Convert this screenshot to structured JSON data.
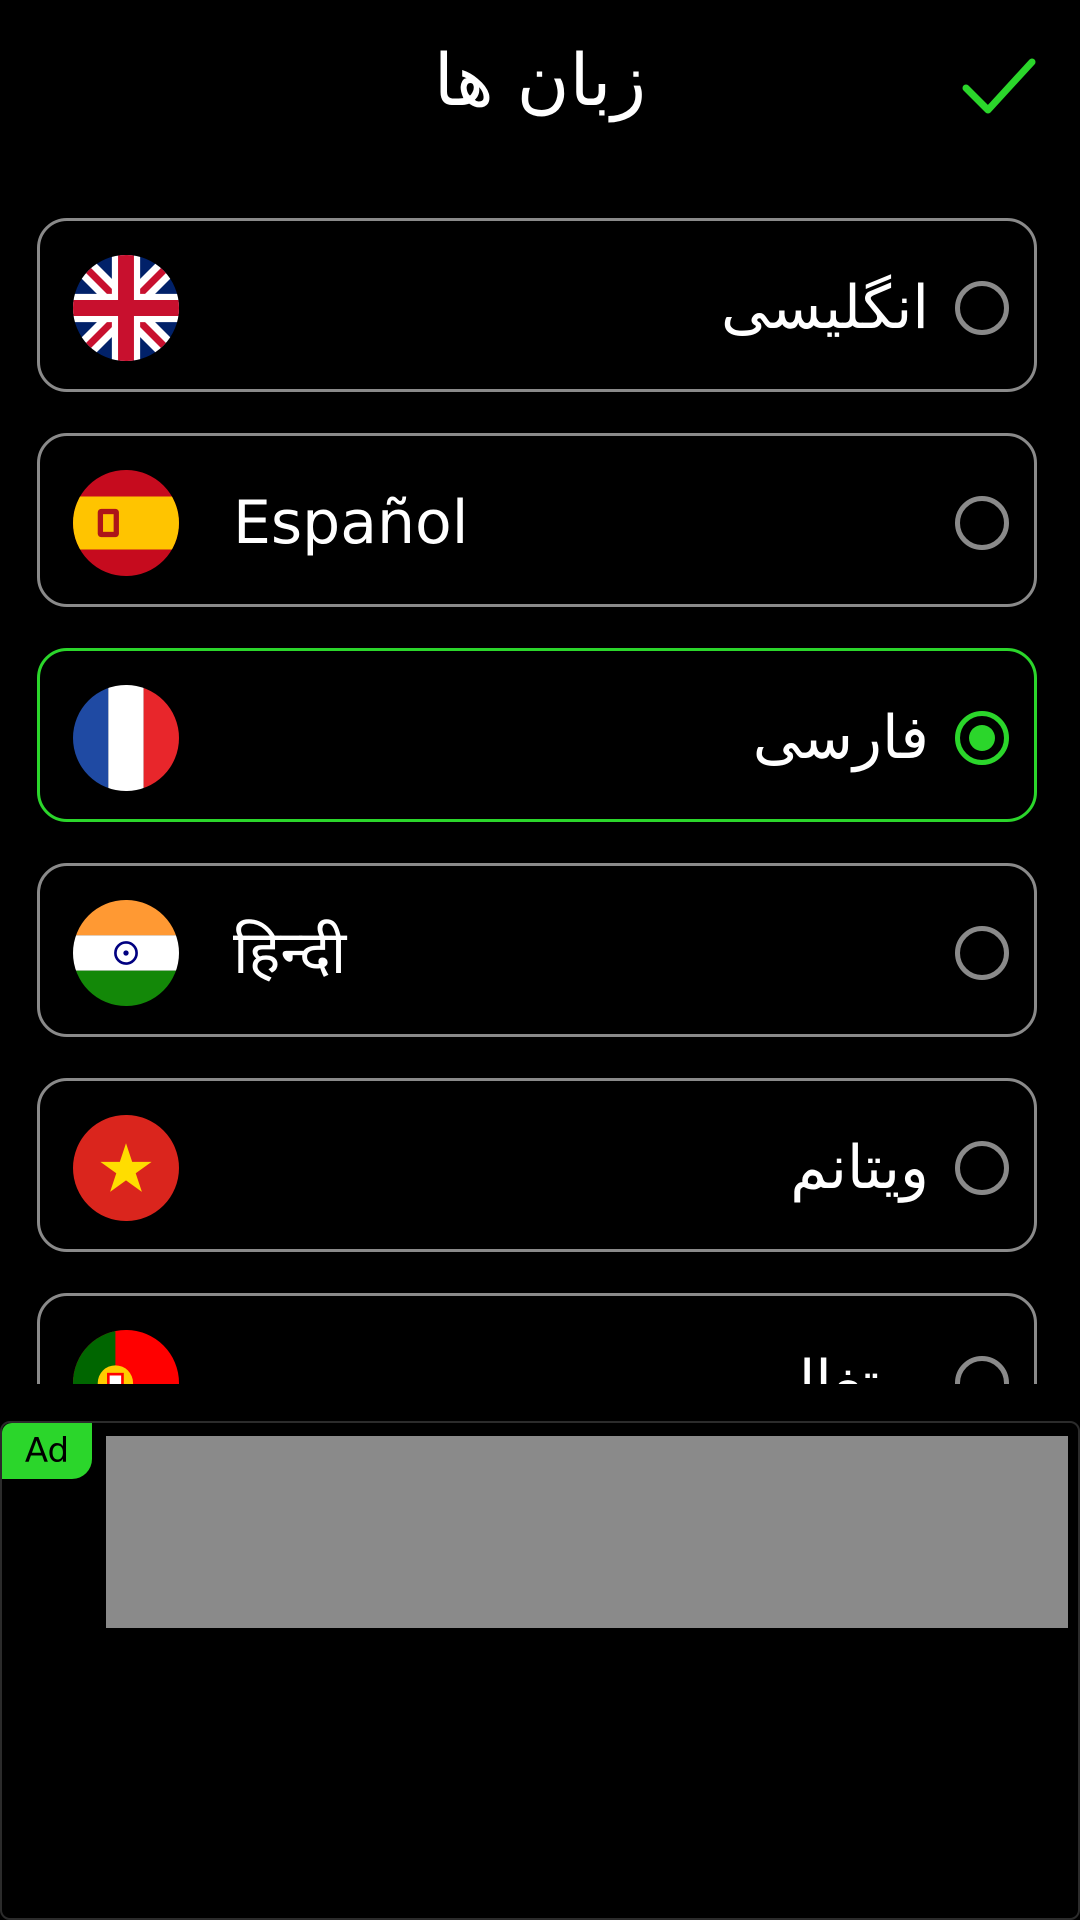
{
  "header": {
    "title": "زبان ها",
    "confirm_icon": "checkmark-icon",
    "accent_color": "#2bd62b"
  },
  "languages": [
    {
      "label": "انگلیسی",
      "flag": "uk-flag-icon",
      "selected": false
    },
    {
      "label": "Español",
      "flag": "spain-flag-icon",
      "selected": false
    },
    {
      "label": "فارسی",
      "flag": "france-flag-icon",
      "selected": true
    },
    {
      "label": "हिन्दी",
      "flag": "india-flag-icon",
      "selected": false
    },
    {
      "label": "ویتانم",
      "flag": "vietnam-flag-icon",
      "selected": false
    },
    {
      "label": "پرتغال",
      "flag": "portugal-flag-icon",
      "selected": false
    }
  ],
  "ad": {
    "badge": "Ad",
    "badge_color": "#2bd62b"
  }
}
